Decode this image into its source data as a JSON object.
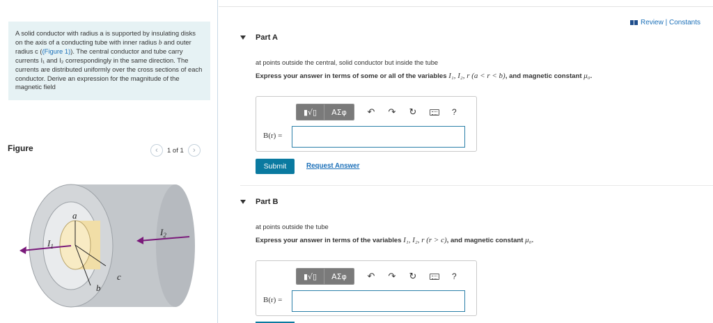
{
  "problem": {
    "intro_pre": "A solid conductor with radius a is supported by insulating disks on the axis of a conducting tube with inner radius ",
    "intro_b": "b",
    "intro_mid": " and outer radius c (",
    "intro_link": "(Figure 1)",
    "intro_post": "). The central conductor and tube carry currents I₁ and I₂ correspondingly in the same direction. The currents are distributed uniformly over the cross sections of each conductor. Derive an expression for the magnitude of the magnetic field"
  },
  "figure": {
    "heading": "Figure",
    "pager_text": "1 of 1",
    "prev_icon": "chevron-left-icon",
    "next_icon": "chevron-right-icon",
    "labels": {
      "a": "a",
      "b": "b",
      "c": "c",
      "I1": "I",
      "I1_sub": "1",
      "I2": "I",
      "I2_sub": "2"
    },
    "colors": {
      "outer_tube": "#c9cdd1",
      "inner_bore": "#e7e9eb",
      "core": "#f6e6b4",
      "arrow": "#7a1a7a"
    }
  },
  "header": {
    "review_label": "Review | Constants"
  },
  "partA": {
    "title": "Part A",
    "condition": "at points outside the central, solid conductor but inside the tube",
    "instruction_pre": "Express your answer in terms of some or all of the variables ",
    "vars": "I₁, I₂, r (a < r < b)",
    "instruction_post": ", and magnetic constant ",
    "mu": "μ₀",
    "period": ".",
    "eq_label": "B(r) =",
    "input_value": ""
  },
  "actions": {
    "submit": "Submit",
    "request": "Request Answer"
  },
  "partB": {
    "title": "Part B",
    "condition": "at points outside the tube",
    "instruction_pre": "Express your answer in terms of the variables ",
    "vars": "I₁, I₂, r (r > c)",
    "instruction_post": ", and magnetic constant ",
    "mu": "μ₀",
    "period": ".",
    "eq_label": "B(r) =",
    "input_value": ""
  },
  "toolbar": {
    "frac_label": "▮√▯",
    "greek_label": "ΑΣφ",
    "undo_icon": "↶",
    "redo_icon": "↷",
    "reset_icon": "↻",
    "keyboard_icon": "keyboard-icon",
    "help_label": "?"
  }
}
